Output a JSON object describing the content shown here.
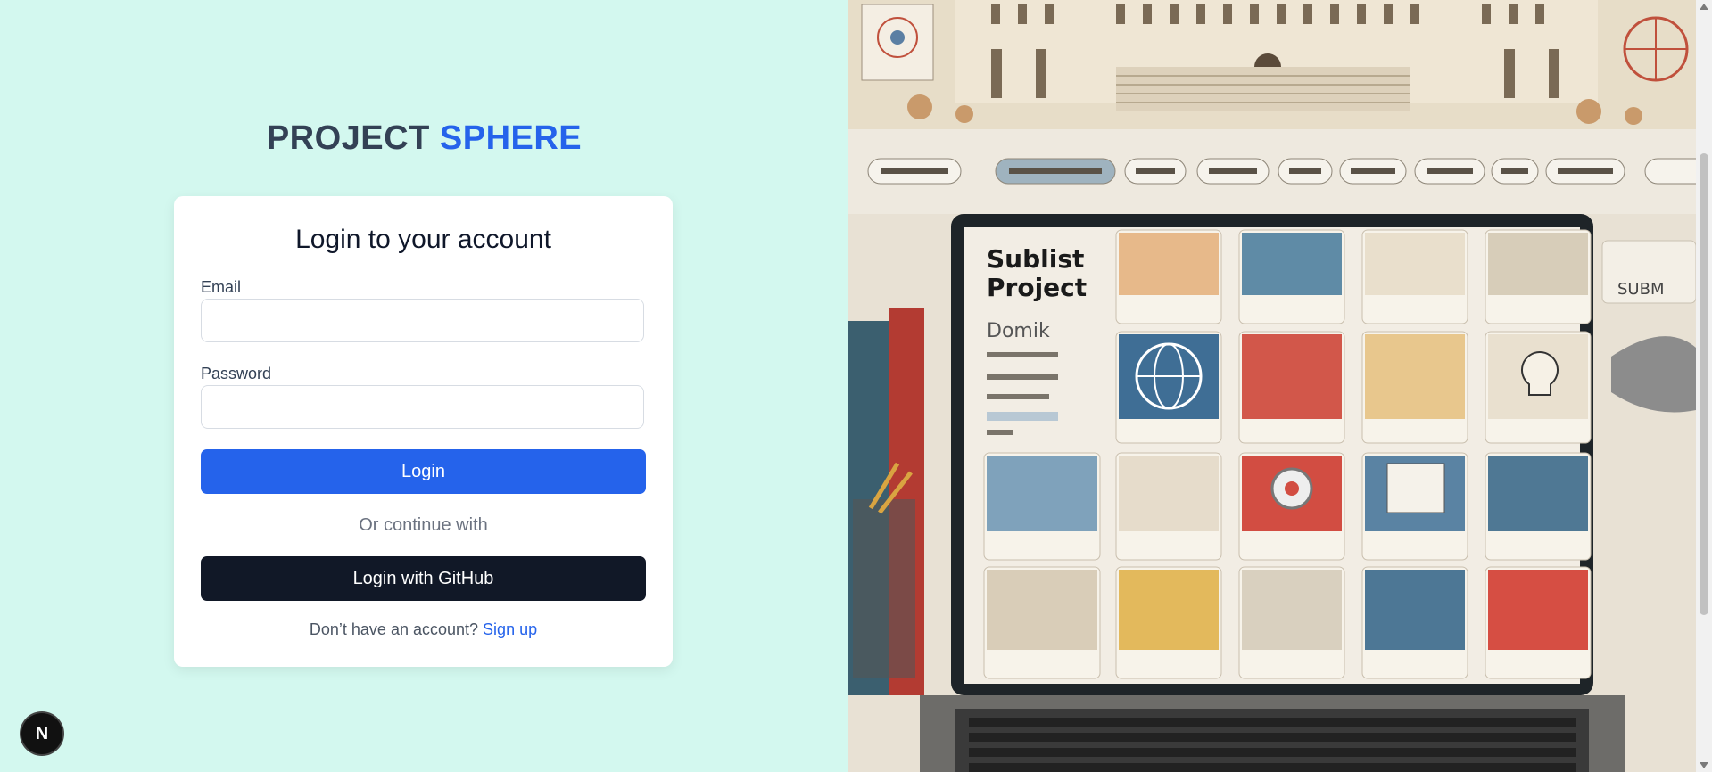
{
  "brand": {
    "part1": "PROJECT",
    "part2": "SPHERE"
  },
  "login_card": {
    "title": "Login to your account",
    "email_label": "Email",
    "email_value": "",
    "password_label": "Password",
    "password_value": "",
    "login_button": "Login",
    "divider_text": "Or continue with",
    "github_button": "Login with GitHub",
    "signup_prompt": "Don’t have an account?",
    "signup_link": "Sign up"
  },
  "hero_image": {
    "visible_text": [
      "Sublist Project",
      "Domik",
      "SUBM"
    ]
  },
  "dev_badge": {
    "letter": "N"
  },
  "colors": {
    "left_background": "#d3f8ef",
    "accent": "#2563eb",
    "dark_button": "#111827"
  }
}
